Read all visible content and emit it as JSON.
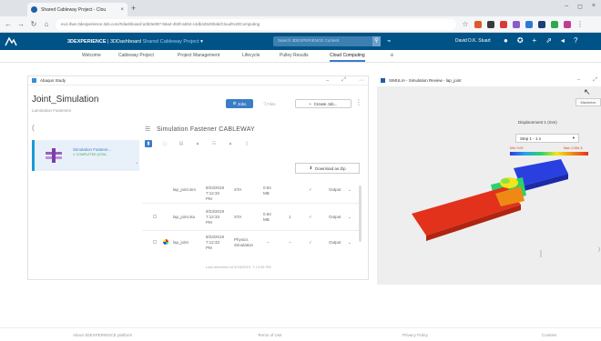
{
  "browser": {
    "tab_title": "Shared Cableway Project - Clou",
    "tab_close": "×",
    "new_tab": "+",
    "url": "eu1-ifwe.3dexperience.3ds.com/#dashboard:a3b0e087-56a4-4b0f-a834-c4db42529/tab/Cloud%20Computing",
    "window_controls": [
      "–",
      "◻",
      "×"
    ]
  },
  "appbar": {
    "brand_bold": "3DEXPERIENCE",
    "brand_rest": " | 3DDashboard",
    "dashboard_name": "Shared Cableway Project",
    "search_placeholder": "Search 3DEXPERIENCE Content",
    "user_name": "David D.K. Stuart"
  },
  "tabs": [
    {
      "label": "Welcome",
      "active": false
    },
    {
      "label": "Cableway Project",
      "active": false
    },
    {
      "label": "Project Management",
      "active": false
    },
    {
      "label": "Lifecycle",
      "active": false
    },
    {
      "label": "Pulley Results",
      "active": false
    },
    {
      "label": "Cloud Computing",
      "active": true
    }
  ],
  "left_widget": {
    "title": "Abaqus Study",
    "study_title": "Joint_Simulation",
    "study_subtitle": "Lamination Fasteners",
    "btn_job": "Jobs",
    "btn_files": "Files",
    "btn_create": "Create Job...",
    "sim_item": {
      "name": "Simulation Fastene...",
      "status": "COMPLETED (COM..."
    },
    "detail_title": "Simulation Fastener CABLEWAY",
    "download_label": "Download as Zip",
    "rows": [
      {
        "name": "lap_joint.sim",
        "date": "9/23/2019\n7:12:32\nPM",
        "type": "STA",
        "size": "0.94\nMB",
        "count": "1",
        "status": "Output"
      },
      {
        "name": "lap_joint.sta",
        "date": "9/23/2019\n7:12:33\nPM",
        "type": "STA",
        "size": "0.94\nMB",
        "count": "1",
        "status": "Output"
      },
      {
        "name": "lap_joint",
        "date": "9/23/2019\n7:12:33\nPM",
        "type": "Physics\nSimulation",
        "size": "–",
        "count": "–",
        "status": "Output"
      }
    ],
    "last_refreshed": "Last refreshed at 9/23/2019, 7:13:36 PM"
  },
  "right_widget": {
    "title": "SIMULIA - Simulation Review - lap_joint",
    "maximize": "Maximize",
    "displacement_label": "Displacement 1 (mm)",
    "step_select": "Step 1 - 1 s",
    "legend_min": "Min: 0.00",
    "legend_max": "Max: 2.00e-3"
  },
  "footer": {
    "about": "About 3DEXPERIENCE platform",
    "terms": "Terms of Use",
    "privacy": "Privacy Policy",
    "cookies": "Cookies"
  },
  "colors": {
    "appbar": "#005386",
    "accent": "#3a7dc7",
    "model_red": "#e3321b",
    "model_blue": "#2a3fe0"
  }
}
